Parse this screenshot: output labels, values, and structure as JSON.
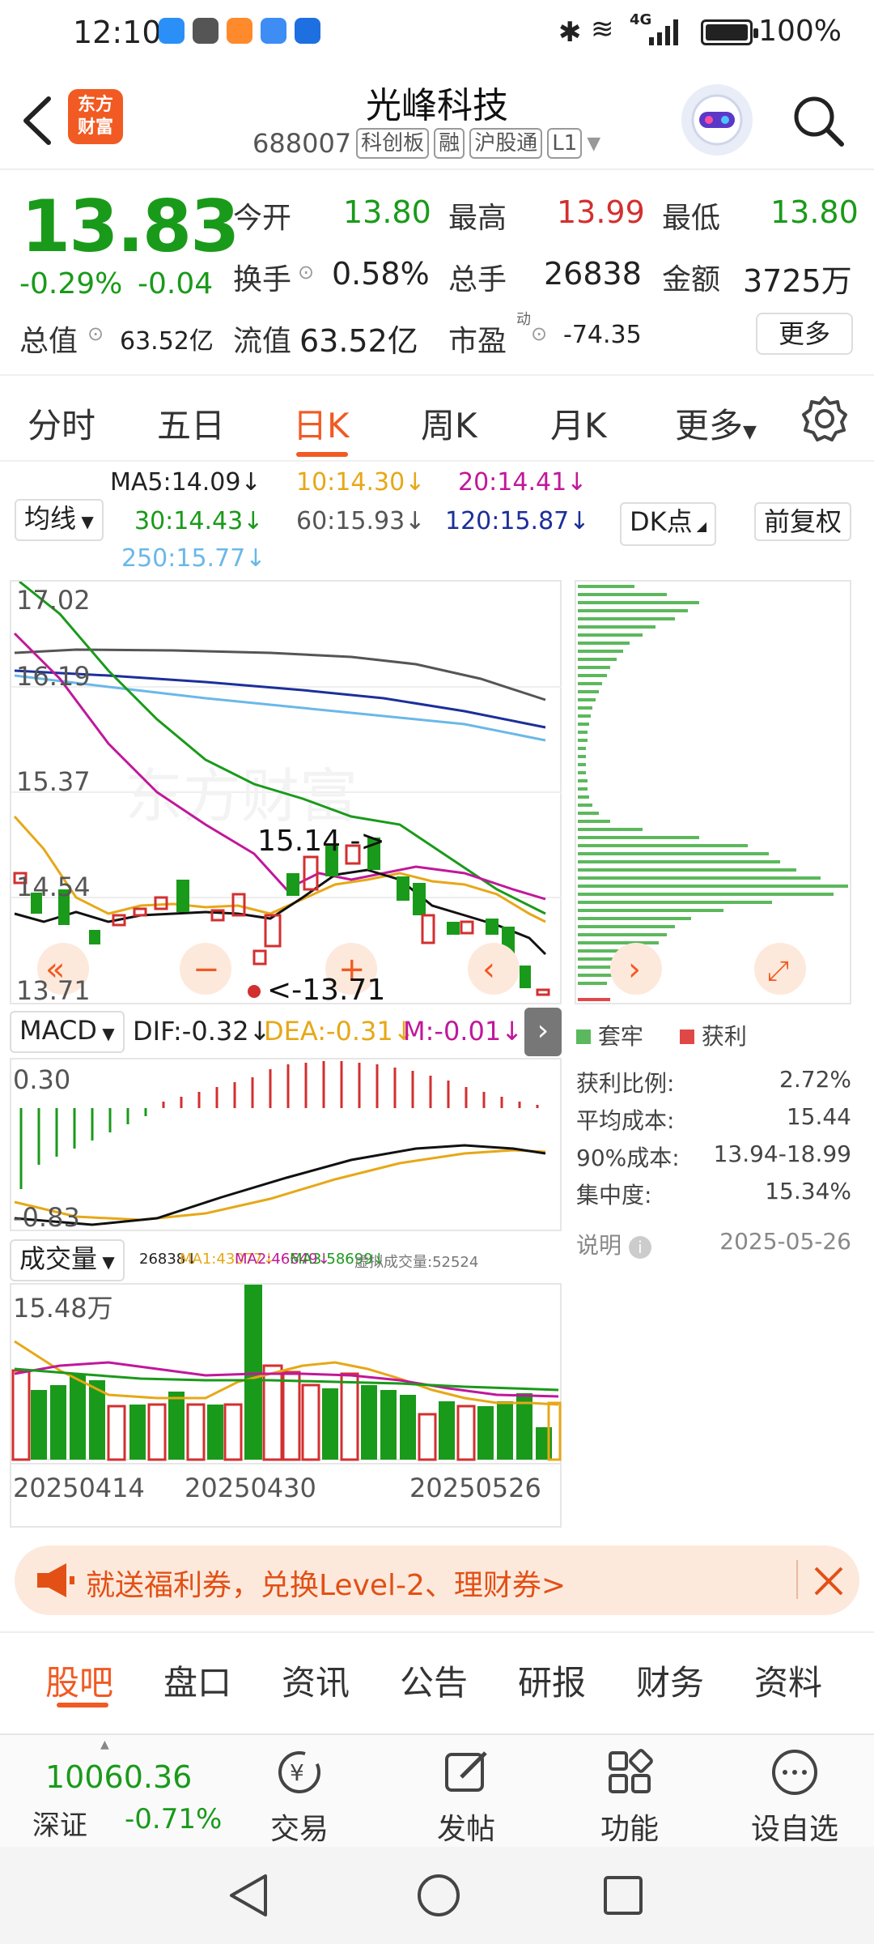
{
  "status": {
    "time": "12:10",
    "network": "4G",
    "battery": "100%"
  },
  "header": {
    "logo_line1": "东方",
    "logo_line2": "财富",
    "stock_name": "光峰科技",
    "code": "688007",
    "tags": [
      "科创板",
      "融",
      "沪股通",
      "L1"
    ]
  },
  "quote": {
    "price": "13.83",
    "chg_pct": "-0.29%",
    "chg_abs": "-0.04",
    "open_label": "今开",
    "open": "13.80",
    "high_label": "最高",
    "high": "13.99",
    "low_label": "最低",
    "low": "13.80",
    "turnover_label": "换手",
    "turnover": "0.58%",
    "volume_label": "总手",
    "volume": "26838",
    "amount_label": "金额",
    "amount": "3725万",
    "mktcap_label": "总值",
    "mktcap": "63.52亿",
    "float_label": "流值",
    "float": "63.52亿",
    "pe_label": "市盈",
    "pe_sup": "动",
    "pe": "-74.35",
    "more": "更多"
  },
  "tabs": [
    "分时",
    "五日",
    "日K",
    "周K",
    "月K",
    "更多"
  ],
  "ma_legend": {
    "ma5": "MA5:14.09↓",
    "ma10": "10:14.30↓",
    "ma20": "20:14.41↓",
    "ma30": "30:14.43↓",
    "ma60": "60:15.93↓",
    "ma120": "120:15.87↓",
    "ma250": "250:15.77↓",
    "selector": "均线",
    "dk": "DK点",
    "adjust": "前复权"
  },
  "kchart": {
    "y_labels": [
      "17.02",
      "16.19",
      "15.37",
      "14.54",
      "13.71"
    ],
    "high_label": "15.14",
    "low_label": "13.71"
  },
  "chip": {
    "legend_trapped": "套牢",
    "legend_profit": "获利",
    "rows": [
      {
        "label": "获利比例:",
        "value": "2.72%"
      },
      {
        "label": "平均成本:",
        "value": "15.44"
      },
      {
        "label": "90%成本:",
        "value": "13.94-18.99"
      },
      {
        "label": "集中度:",
        "value": "15.34%"
      }
    ],
    "note": "说明",
    "date": "2025-05-26"
  },
  "macd": {
    "name": "MACD",
    "dif": "DIF:-0.32↓",
    "dea": "DEA:-0.31↓",
    "m": "M:-0.01↓",
    "y_top": "0.30",
    "y_bottom": "-0.83"
  },
  "volume": {
    "name": "成交量",
    "v": "26838↓",
    "ma1": "MA1:43077↓",
    "ma2": "MA2:46649↓",
    "ma3": "MA3:58699↓",
    "virtual": "虚拟成交量:52524",
    "y_top": "15.48万",
    "dates": [
      "20250414",
      "20250430",
      "20250526"
    ]
  },
  "banner": {
    "text": "就送福利券，兑换Level-2、理财券>"
  },
  "bottom_tabs": [
    "股吧",
    "盘口",
    "资讯",
    "公告",
    "研报",
    "财务",
    "资料"
  ],
  "bottom_bar": {
    "index_value": "10060.36",
    "index_name": "深证",
    "index_chg": "-0.71%",
    "items": [
      "交易",
      "发帖",
      "功能",
      "设自选"
    ]
  },
  "colors": {
    "accent": "#f15a22",
    "up": "#d32f2f",
    "down": "#1a9a1a"
  }
}
